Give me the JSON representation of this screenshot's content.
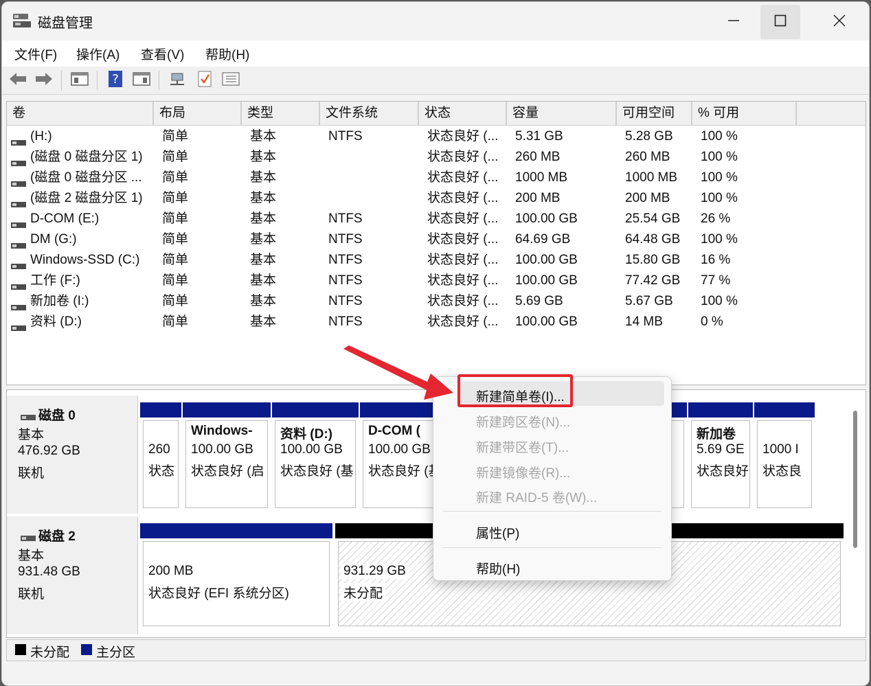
{
  "window": {
    "title": "磁盘管理"
  },
  "menu": [
    "文件(F)",
    "操作(A)",
    "查看(V)",
    "帮助(H)"
  ],
  "toolbar_icons": [
    "back-icon",
    "forward-icon",
    "console-icon",
    "help-icon",
    "properties-icon",
    "connect-icon",
    "check-icon",
    "list-icon"
  ],
  "columns": [
    "卷",
    "布局",
    "类型",
    "文件系统",
    "状态",
    "容量",
    "可用空间",
    "% 可用"
  ],
  "volumes": [
    {
      "name": "(H:)",
      "layout": "简单",
      "type": "基本",
      "fs": "NTFS",
      "status": "状态良好 (...",
      "capacity": "5.31 GB",
      "free": "5.28 GB",
      "pct": "100 %"
    },
    {
      "name": "(磁盘 0 磁盘分区 1)",
      "layout": "简单",
      "type": "基本",
      "fs": "",
      "status": "状态良好 (...",
      "capacity": "260 MB",
      "free": "260 MB",
      "pct": "100 %"
    },
    {
      "name": "(磁盘 0 磁盘分区 ...",
      "layout": "简单",
      "type": "基本",
      "fs": "",
      "status": "状态良好 (...",
      "capacity": "1000 MB",
      "free": "1000 MB",
      "pct": "100 %"
    },
    {
      "name": "(磁盘 2 磁盘分区 1)",
      "layout": "简单",
      "type": "基本",
      "fs": "",
      "status": "状态良好 (...",
      "capacity": "200 MB",
      "free": "200 MB",
      "pct": "100 %"
    },
    {
      "name": "D-COM (E:)",
      "layout": "简单",
      "type": "基本",
      "fs": "NTFS",
      "status": "状态良好 (...",
      "capacity": "100.00 GB",
      "free": "25.54 GB",
      "pct": "26 %"
    },
    {
      "name": "DM (G:)",
      "layout": "简单",
      "type": "基本",
      "fs": "NTFS",
      "status": "状态良好 (...",
      "capacity": "64.69 GB",
      "free": "64.48 GB",
      "pct": "100 %"
    },
    {
      "name": "Windows-SSD (C:)",
      "layout": "简单",
      "type": "基本",
      "fs": "NTFS",
      "status": "状态良好 (...",
      "capacity": "100.00 GB",
      "free": "15.80 GB",
      "pct": "16 %"
    },
    {
      "name": "工作 (F:)",
      "layout": "简单",
      "type": "基本",
      "fs": "NTFS",
      "status": "状态良好 (...",
      "capacity": "100.00 GB",
      "free": "77.42 GB",
      "pct": "77 %"
    },
    {
      "name": "新加卷 (I:)",
      "layout": "简单",
      "type": "基本",
      "fs": "NTFS",
      "status": "状态良好 (...",
      "capacity": "5.69 GB",
      "free": "5.67 GB",
      "pct": "100 %"
    },
    {
      "name": "资料 (D:)",
      "layout": "简单",
      "type": "基本",
      "fs": "NTFS",
      "status": "状态良好 (...",
      "capacity": "100.00 GB",
      "free": "14 MB",
      "pct": "0 %"
    }
  ],
  "disk0": {
    "name": "磁盘 0",
    "kind": "基本",
    "size": "476.92 GB",
    "state": "联机",
    "partitions": [
      {
        "l1": "",
        "l2": "260",
        "l3": "状态"
      },
      {
        "l1": "Windows-",
        "l2": "100.00 GB",
        "l3": "状态良好 (启"
      },
      {
        "l1": "资料 (D:)",
        "l2": "100.00 GB",
        "l3": "状态良好 (基"
      },
      {
        "l1": "D-COM (",
        "l2": "100.00 GB",
        "l3": "状态良好 (基"
      },
      {
        "l1": "",
        "l2": "",
        "l3": ""
      },
      {
        "l1": "新加卷",
        "l2": "5.69 GE",
        "l3": "状态良好"
      },
      {
        "l1": "",
        "l2": "1000 I",
        "l3": "状态良"
      }
    ]
  },
  "disk2": {
    "name": "磁盘 2",
    "kind": "基本",
    "size": "931.48 GB",
    "state": "联机",
    "partitions": [
      {
        "l1": "200 MB",
        "l2": "状态良好 (EFI 系统分区)"
      },
      {
        "l1": "931.29 GB",
        "l2": "未分配"
      }
    ]
  },
  "legend": {
    "unallocated": "未分配",
    "primary": "主分区"
  },
  "context_menu": {
    "items": [
      {
        "label": "新建简单卷(I)...",
        "enabled": true
      },
      {
        "label": "新建跨区卷(N)...",
        "enabled": false
      },
      {
        "label": "新建带区卷(T)...",
        "enabled": false
      },
      {
        "label": "新建镜像卷(R)...",
        "enabled": false
      },
      {
        "label": "新建 RAID-5 卷(W)...",
        "enabled": false
      },
      {
        "label": "属性(P)",
        "enabled": true
      },
      {
        "label": "帮助(H)",
        "enabled": true
      }
    ]
  },
  "colors": {
    "primary": "#0a1a8a",
    "unallocated": "#000000",
    "annotation": "#e3262f"
  }
}
